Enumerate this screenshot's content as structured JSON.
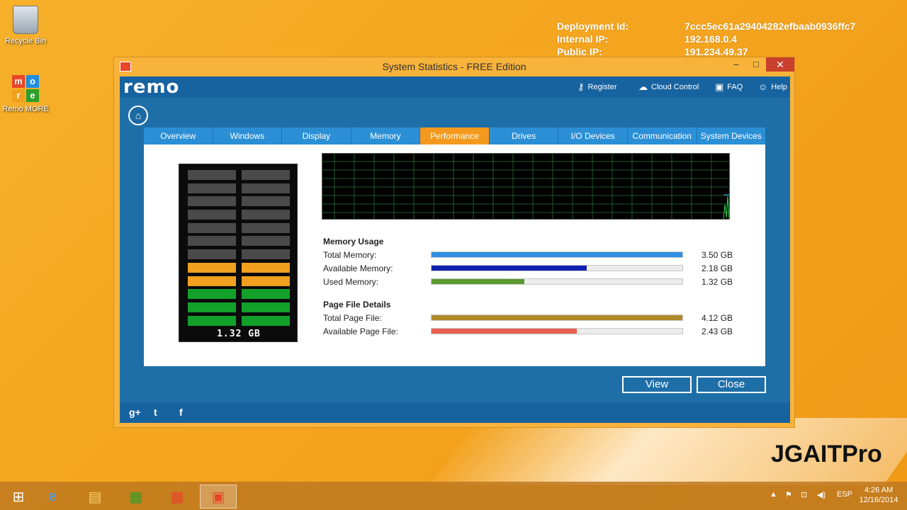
{
  "desktop": {
    "icons": [
      {
        "label": "Recycle Bin"
      },
      {
        "label": "Remo MORE"
      }
    ],
    "remo_letters": [
      "m",
      "o",
      "r",
      "e"
    ],
    "deployment": [
      {
        "key": "Deployment Id:",
        "value": "7ccc5ec61a29404282efbaab0936ffc7"
      },
      {
        "key": "Internal IP:",
        "value": "192.168.0.4"
      },
      {
        "key": "Public IP:",
        "value": "191.234.49.37"
      }
    ],
    "watermark": "JGAITPro"
  },
  "window": {
    "title": "System Statistics - FREE Edition",
    "controls": {
      "minimize": "–",
      "maximize": "□",
      "close": "✕"
    }
  },
  "app": {
    "logo": "remo",
    "header_links": [
      {
        "label": "Register",
        "icon": "key-icon"
      },
      {
        "label": "Cloud Control",
        "icon": "cloud-icon"
      },
      {
        "label": "FAQ",
        "icon": "book-icon"
      },
      {
        "label": "Help",
        "icon": "person-icon"
      }
    ],
    "tabs": [
      "Overview",
      "Windows",
      "Display",
      "Memory",
      "Performance",
      "Drives",
      "I/O Devices",
      "Communication",
      "System Devices"
    ],
    "active_tab": "Performance",
    "meter": {
      "value": "1.32 GB",
      "used_fraction": 0.38
    },
    "memory_usage": {
      "title": "Memory Usage",
      "rows": [
        {
          "label": "Total Memory:",
          "value": "3.50 GB",
          "fraction": 1.0,
          "color": "#2f8fe0"
        },
        {
          "label": "Available Memory:",
          "value": "2.18 GB",
          "fraction": 0.62,
          "color": "#1020b0"
        },
        {
          "label": "Used Memory:",
          "value": "1.32 GB",
          "fraction": 0.37,
          "color": "#5a9a30"
        }
      ]
    },
    "page_file": {
      "title": "Page File Details",
      "rows": [
        {
          "label": "Total Page File:",
          "value": "4.12 GB",
          "fraction": 1.0,
          "color": "#b08a2a"
        },
        {
          "label": "Available Page File:",
          "value": "2.43 GB",
          "fraction": 0.58,
          "color": "#e86050"
        }
      ]
    },
    "buttons": {
      "view": "View",
      "close": "Close"
    },
    "social": [
      "g+",
      "t",
      "f"
    ]
  },
  "taskbar": {
    "language": "ESP",
    "time": "4:26 AM",
    "date": "12/16/2014"
  },
  "colors": {
    "accent_orange": "#f39a1e",
    "tab_blue": "#2b8fd6",
    "window_blue": "#1e6fa8"
  }
}
